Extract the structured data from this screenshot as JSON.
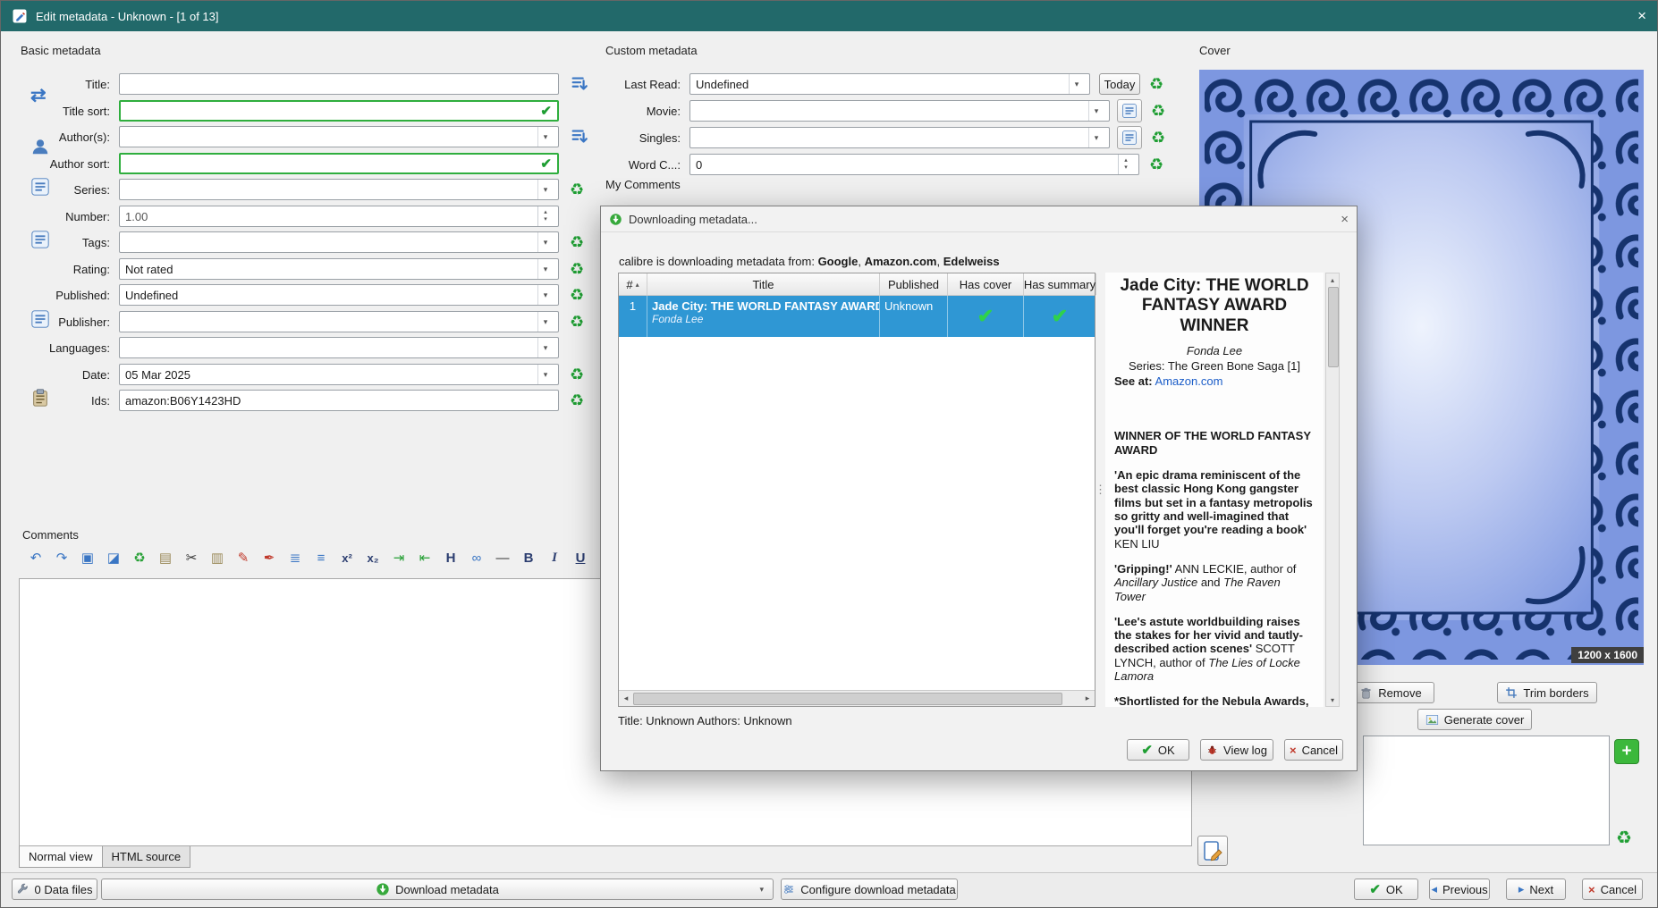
{
  "window": {
    "title": "Edit metadata - Unknown - [1 of 13]"
  },
  "icons": {
    "close": "×",
    "dropdown": "▾",
    "up": "▴",
    "down": "▾",
    "left": "◂",
    "right": "▸",
    "check": "✔",
    "recycle": "♻",
    "swap": "⇄",
    "undo": "↶",
    "redo": "↷",
    "select_all": "▣",
    "erase": "◪",
    "copy": "▤",
    "cut": "✂",
    "paste": "▥",
    "highlight": "✎",
    "pen": "✒",
    "olist": "≣",
    "ulist": "≡",
    "sup": "x²",
    "sub": "x₂",
    "indent_more": "⇥",
    "indent_less": "⇤",
    "heading": "H",
    "link": "∞",
    "hr": "―",
    "bold": "B",
    "italic": "I",
    "underline": "U",
    "splitter_dots": "⋮",
    "plus": "+",
    "sort_asc": "▴"
  },
  "basic": {
    "section_title": "Basic metadata",
    "title": {
      "label": "Title:",
      "value": ""
    },
    "title_sort": {
      "label": "Title sort:",
      "value": ""
    },
    "authors": {
      "label": "Author(s):",
      "value": ""
    },
    "author_sort": {
      "label": "Author sort:",
      "value": ""
    },
    "series": {
      "label": "Series:",
      "value": ""
    },
    "number": {
      "label": "Number:",
      "value": "1.00"
    },
    "tags": {
      "label": "Tags:",
      "value": ""
    },
    "rating": {
      "label": "Rating:",
      "value": "Not rated"
    },
    "published": {
      "label": "Published:",
      "value": "Undefined"
    },
    "publisher": {
      "label": "Publisher:",
      "value": ""
    },
    "languages": {
      "label": "Languages:",
      "value": ""
    },
    "date": {
      "label": "Date:",
      "value": "05 Mar 2025"
    },
    "ids": {
      "label": "Ids:",
      "value": "amazon:B06Y1423HD"
    }
  },
  "custom": {
    "section_title": "Custom metadata",
    "last_read": {
      "label": "Last Read:",
      "value": "Undefined",
      "today_label": "Today"
    },
    "movie": {
      "label": "Movie:",
      "value": ""
    },
    "singles": {
      "label": "Singles:",
      "value": ""
    },
    "word_count": {
      "label": "Word C...:",
      "value": "0"
    },
    "my_comments_label": "My Comments"
  },
  "comments": {
    "section_title": "Comments",
    "tabs": [
      {
        "label": "Normal view"
      },
      {
        "label": "HTML source"
      }
    ]
  },
  "cover": {
    "section_title": "Cover",
    "size_badge": "1200 x 1600",
    "remove_label": "Remove",
    "trim_label": "Trim borders",
    "generate_label": "Generate cover"
  },
  "dialog": {
    "title": "Downloading metadata...",
    "message_prefix": "calibre is downloading metadata from: ",
    "source1": "Google",
    "sep": ", ",
    "source2": "Amazon.com",
    "source3": "Edelweiss",
    "table": {
      "headers": [
        "#",
        "Title",
        "Published",
        "Has cover",
        "Has summary"
      ],
      "row": {
        "num": "1",
        "title": "Jade City: THE WORLD FANTASY AWARD WIN",
        "author": "Fonda Lee",
        "published": "Unknown"
      }
    },
    "book": {
      "title": "Jade City: THE WORLD FANTASY AWARD WINNER",
      "author": "Fonda Lee",
      "series": "Series: The Green Bone Saga [1]",
      "see_at": "See at:",
      "store_link": "Amazon.com",
      "p1": "WINNER OF THE WORLD FANTASY AWARD",
      "p2_quote": "'An epic drama reminiscent of the best classic Hong Kong gangster films but set in a fantasy metropolis so gritty and well-imagined that you'll forget you're reading a book'",
      "p2_attr": " KEN LIU",
      "p3_quote": "'Gripping!'",
      "p3_mid": " ANN LECKIE, author of ",
      "p3_title1": "Ancillary Justice",
      "p3_and": " and ",
      "p3_title2": "The Raven Tower",
      "p4_quote": "'Lee's astute worldbuilding raises the stakes for her vivid and tautly-described action scenes'",
      "p4_mid": " SCOTT LYNCH, author of ",
      "p4_title1": "The Lies of Locke Lamora",
      "p5": "*Shortlisted for the Nebula Awards, the"
    },
    "status": "Title: Unknown Authors: Unknown",
    "ok_label": "OK",
    "view_log_label": "View log",
    "cancel_label": "Cancel"
  },
  "bottom": {
    "data_files_label": "0 Data files",
    "download_label": "Download metadata",
    "configure_label": "Configure download metadata",
    "ok_label": "OK",
    "previous_label": "Previous",
    "next_label": "Next",
    "cancel_label": "Cancel"
  }
}
